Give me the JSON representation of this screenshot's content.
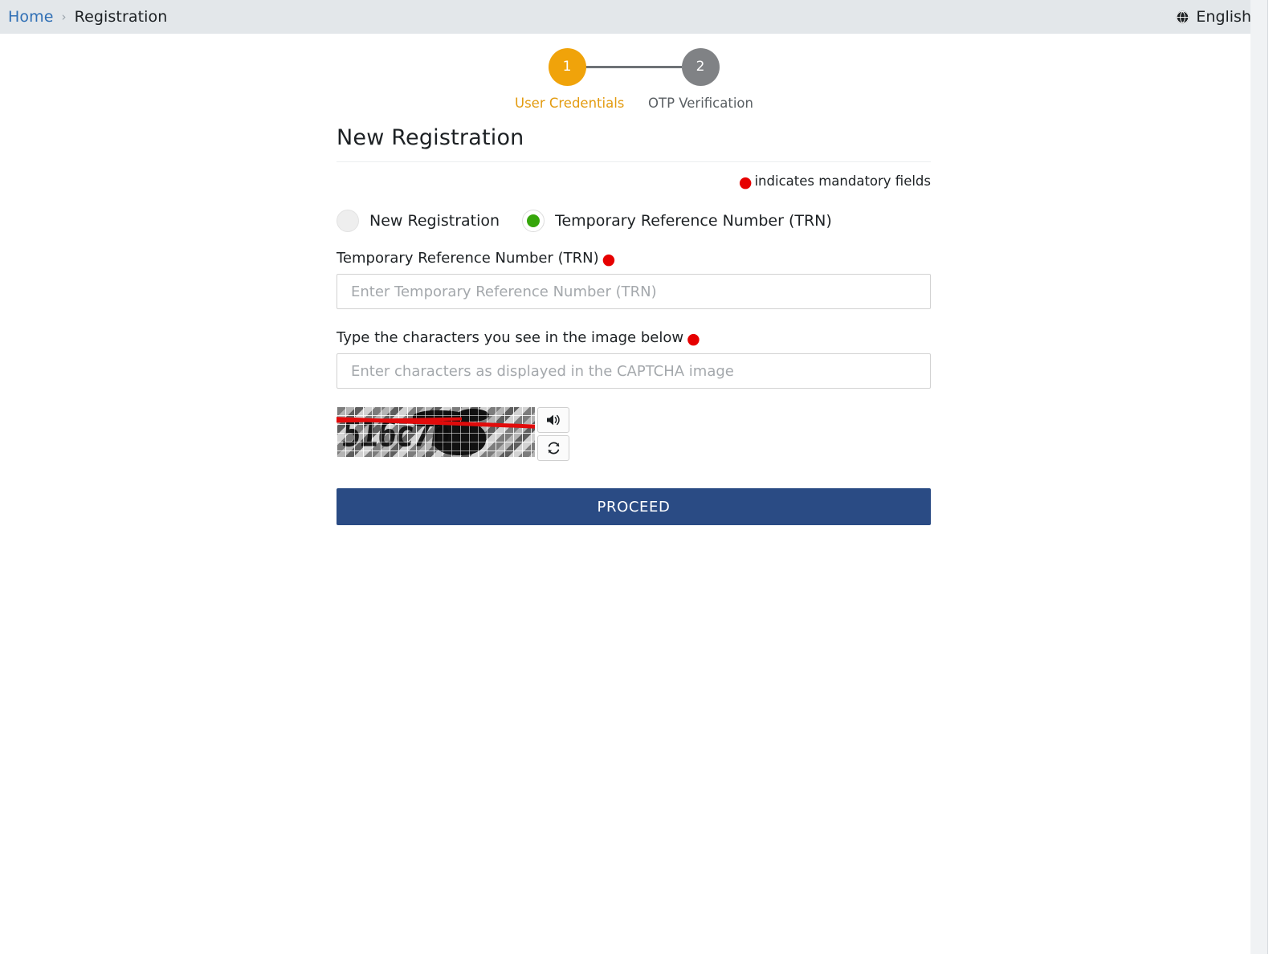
{
  "header": {
    "breadcrumb": {
      "home": "Home",
      "separator": "›",
      "current": "Registration"
    },
    "language": {
      "label": "English",
      "icon": "globe-icon"
    },
    "background_color": "#e3e7ea"
  },
  "stepper": {
    "steps": [
      {
        "number": "1",
        "label": "User Credentials",
        "state": "active",
        "color": "#f0a30a"
      },
      {
        "number": "2",
        "label": "OTP Verification",
        "state": "inactive",
        "color": "#808285"
      }
    ]
  },
  "form": {
    "title": "New Registration",
    "mandatory_note": "indicates mandatory fields",
    "required_marker": "●",
    "required_color": "#e60000",
    "registration_type": {
      "options": [
        {
          "label": "New Registration",
          "selected": false
        },
        {
          "label": "Temporary Reference Number (TRN)",
          "selected": true
        }
      ],
      "selected_color": "#36a60b"
    },
    "trn_field": {
      "label": "Temporary Reference Number (TRN)",
      "placeholder": "Enter Temporary Reference Number (TRN)",
      "value": ""
    },
    "captcha_field": {
      "label": "Type the characters you see in the image below",
      "placeholder": "Enter characters as displayed in the CAPTCHA image",
      "value": "",
      "image_text": "516c7b",
      "audio_button_icon": "speaker-icon",
      "refresh_button_icon": "refresh-icon"
    },
    "submit": {
      "label": "PROCEED",
      "color": "#2a4b84"
    }
  }
}
